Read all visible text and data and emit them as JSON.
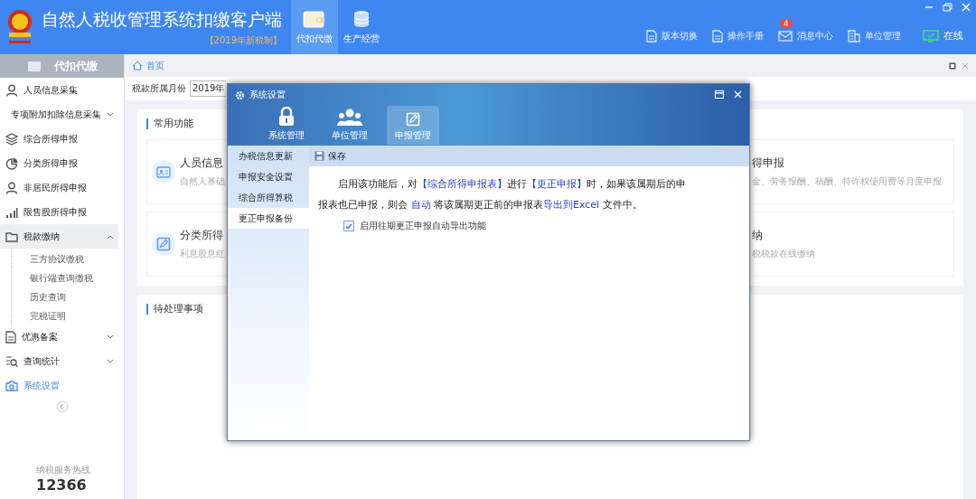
{
  "app": {
    "title": "自然人税收管理系统扣缴客户端",
    "edition": "【2019年新税制】"
  },
  "top_tabs": [
    {
      "label": "代扣代缴",
      "selected": true
    },
    {
      "label": "生产经营",
      "selected": false
    }
  ],
  "toolbar": [
    {
      "label": "版本切换"
    },
    {
      "label": "操作手册"
    },
    {
      "label": "消息中心",
      "badge": "4"
    },
    {
      "label": "单位管理"
    }
  ],
  "status": {
    "label": "在线"
  },
  "sidebar": {
    "title": "代扣代缴",
    "items": [
      {
        "label": "人员信息采集",
        "kind": "link",
        "selected": false
      },
      {
        "label": "专项附加扣除信息采集",
        "kind": "group",
        "expanded": false,
        "selected": false
      },
      {
        "label": "综合所得申报",
        "kind": "link",
        "selected": false
      },
      {
        "label": "分类所得申报",
        "kind": "link",
        "selected": false
      },
      {
        "label": "非居民所得申报",
        "kind": "link",
        "selected": false
      },
      {
        "label": "限售股所得申报",
        "kind": "link",
        "selected": false
      },
      {
        "label": "税款缴纳",
        "kind": "group",
        "expanded": true,
        "selected": false,
        "children": [
          {
            "label": "三方协议缴税"
          },
          {
            "label": "银行端查询缴税"
          },
          {
            "label": "历史查询"
          },
          {
            "label": "完税证明"
          }
        ]
      },
      {
        "label": "优惠备案",
        "kind": "group",
        "expanded": false,
        "selected": false
      },
      {
        "label": "查询统计",
        "kind": "group",
        "expanded": false,
        "selected": false
      },
      {
        "label": "系统设置",
        "kind": "link",
        "selected": true
      }
    ],
    "hotline": {
      "caption": "纳税服务热线",
      "number": "12366"
    }
  },
  "breadcrumb": "首页",
  "filter": {
    "label": "税款所属月份",
    "value": "2019年"
  },
  "common": {
    "title": "常用功能",
    "cards": [
      {
        "title": "人员信息",
        "desc": "自然人基础"
      },
      {
        "title": "得申报",
        "desc": "金、劳务报酬、稿酬、特许权使用费等月度申报"
      },
      {
        "title": "分类所得",
        "desc": "利息股息红"
      },
      {
        "title": "纳",
        "desc": "税税款在线缴纳"
      }
    ]
  },
  "pending": {
    "title": "待处理事项"
  },
  "dialog": {
    "title": "系统设置",
    "tabs": [
      {
        "label": "系统管理",
        "selected": false
      },
      {
        "label": "单位管理",
        "selected": false
      },
      {
        "label": "申报管理",
        "selected": true
      }
    ],
    "menu": [
      {
        "label": "办税信息更新",
        "selected": false
      },
      {
        "label": "申报安全设置",
        "selected": false
      },
      {
        "label": "综合所得算税",
        "selected": false
      },
      {
        "label": "更正申报备份",
        "selected": true
      }
    ],
    "save": "保存",
    "description": [
      {
        "text": "启用该功能后，对",
        "kind": "plain"
      },
      {
        "text": "【综合所得申报表】",
        "kind": "link"
      },
      {
        "text": "进行",
        "kind": "plain"
      },
      {
        "text": "【更正申报】",
        "kind": "link"
      },
      {
        "text": "时，如果该属期后的申报表也已申报，则会 ",
        "kind": "plain"
      },
      {
        "text": "自动",
        "kind": "link"
      },
      {
        "text": " 将该属期更正前的申报表",
        "kind": "plain"
      },
      {
        "text": "导出到Excel",
        "kind": "link"
      },
      {
        "text": " 文件中。",
        "kind": "plain"
      }
    ],
    "option": {
      "label": "启用往期更正申报自动导出功能",
      "checked": true
    }
  }
}
